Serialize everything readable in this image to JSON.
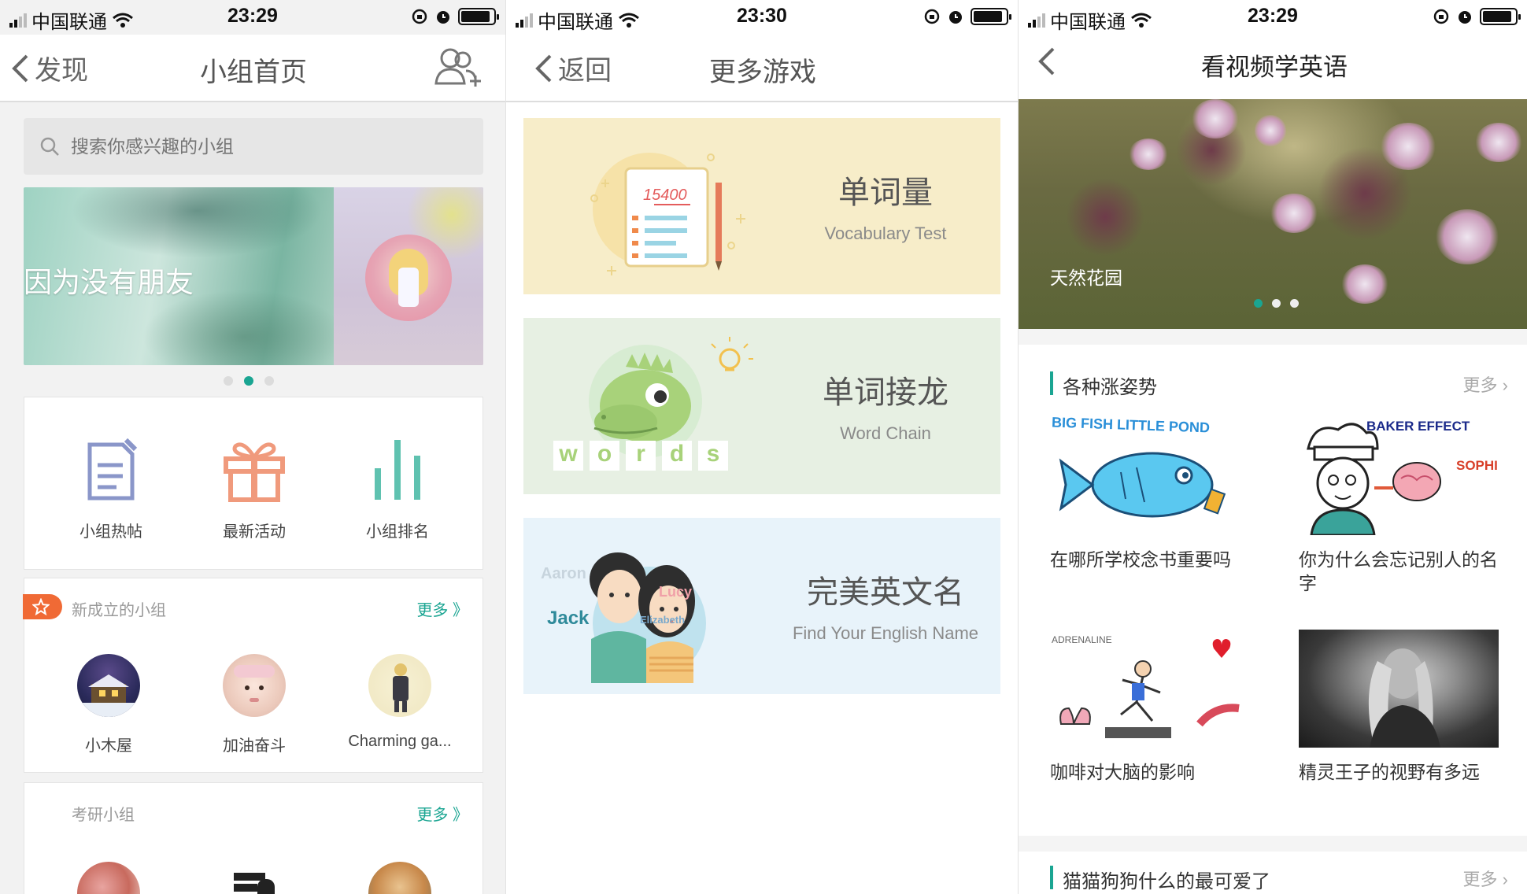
{
  "screens": [
    {
      "status": {
        "carrier": "中国联通",
        "time": "23:29"
      },
      "nav": {
        "back_label": "发现",
        "title": "小组首页"
      },
      "search": {
        "placeholder": "搜索你感兴趣的小组"
      },
      "banner": {
        "caption": "因为没有朋友",
        "page_index": 1,
        "page_count": 3
      },
      "features": [
        {
          "label": "小组热帖",
          "icon": "document-edit-icon",
          "color": "#8a96c9"
        },
        {
          "label": "最新活动",
          "icon": "gift-icon",
          "color": "#f09a7c"
        },
        {
          "label": "小组排名",
          "icon": "bar-chart-icon",
          "color": "#5fc2b0"
        }
      ],
      "new_groups": {
        "title": "新成立的小组",
        "more": "更多 》",
        "items": [
          {
            "name": "小木屋"
          },
          {
            "name": "加油奋斗"
          },
          {
            "name": "Charming ga..."
          }
        ]
      },
      "exam_groups": {
        "title": "考研小组",
        "more": "更多 》"
      }
    },
    {
      "status": {
        "carrier": "中国联通",
        "time": "23:30"
      },
      "nav": {
        "back_label": "返回",
        "title": "更多游戏"
      },
      "games": [
        {
          "title": "单词量",
          "subtitle": "Vocabulary Test",
          "bg": "#f7edc9",
          "note_number": "15400"
        },
        {
          "title": "单词接龙",
          "subtitle": "Word Chain",
          "bg": "#e7f0e3",
          "letters": [
            "w",
            "o",
            "r",
            "d",
            "s"
          ]
        },
        {
          "title": "完美英文名",
          "subtitle": "Find Your English Name",
          "bg": "#e8f3fa",
          "names": [
            "Aaron",
            "Jack",
            "Lucy",
            "Elizabeth"
          ]
        }
      ]
    },
    {
      "status": {
        "carrier": "中国联通",
        "time": "23:29"
      },
      "nav": {
        "title": "看视频学英语"
      },
      "banner": {
        "caption": "天然花园",
        "page_index": 0,
        "page_count": 3
      },
      "sections": [
        {
          "title": "各种涨姿势",
          "more": "更多",
          "videos": [
            {
              "title": "在哪所学校念书重要吗",
              "thumb_text": "BIG FISH LITTLE POND"
            },
            {
              "title": "你为什么会忘记别人的名字",
              "thumb_text": "BAKER EFFECT",
              "thumb_text_2": "SOPHI"
            },
            {
              "title": "咖啡对大脑的影响",
              "thumb_text": "ADRENALINE"
            },
            {
              "title": "精灵王子的视野有多远"
            }
          ]
        },
        {
          "title": "猫猫狗狗什么的最可爱了",
          "more": "更多"
        }
      ]
    }
  ]
}
